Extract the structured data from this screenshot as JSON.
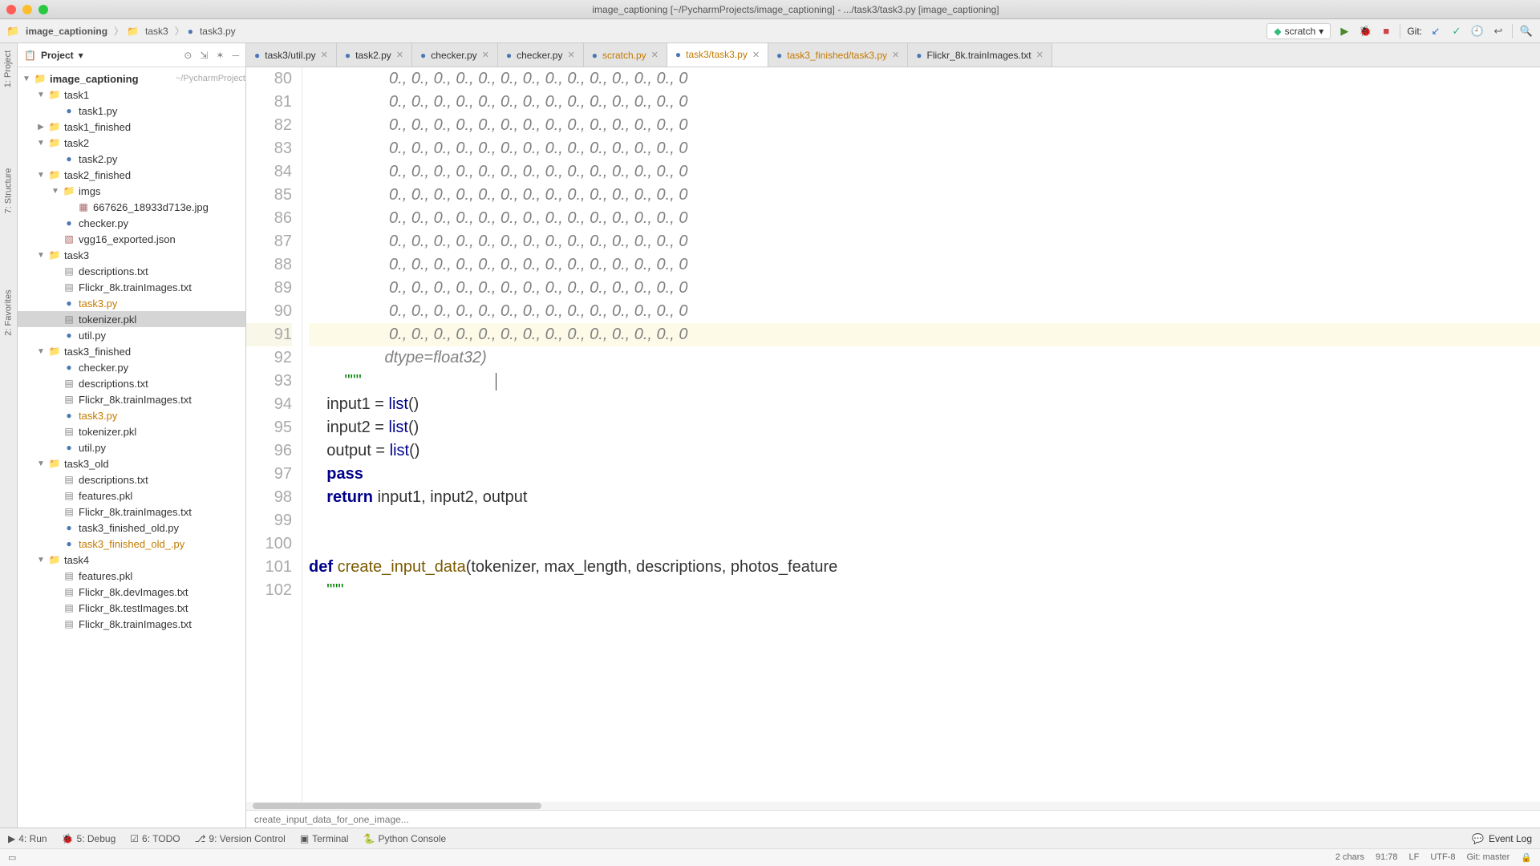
{
  "title": "image_captioning [~/PycharmProjects/image_captioning] - .../task3/task3.py [image_captioning]",
  "breadcrumbs": [
    "image_captioning",
    "task3",
    "task3.py"
  ],
  "run_config": "scratch",
  "git_label": "Git:",
  "project": {
    "label": "Project",
    "root": {
      "name": "image_captioning",
      "hint": "~/PycharmProject"
    }
  },
  "tree": [
    {
      "depth": 0,
      "arrow": "▼",
      "type": "folder",
      "name": "image_captioning",
      "hint": "~/PycharmProject",
      "bold": true
    },
    {
      "depth": 1,
      "arrow": "▼",
      "type": "folder",
      "name": "task1"
    },
    {
      "depth": 2,
      "arrow": "",
      "type": "py",
      "name": "task1.py"
    },
    {
      "depth": 1,
      "arrow": "▶",
      "type": "folder",
      "name": "task1_finished"
    },
    {
      "depth": 1,
      "arrow": "▼",
      "type": "folder",
      "name": "task2"
    },
    {
      "depth": 2,
      "arrow": "",
      "type": "py",
      "name": "task2.py"
    },
    {
      "depth": 1,
      "arrow": "▼",
      "type": "folder",
      "name": "task2_finished"
    },
    {
      "depth": 2,
      "arrow": "▼",
      "type": "folder",
      "name": "imgs"
    },
    {
      "depth": 3,
      "arrow": "",
      "type": "jpg",
      "name": "667626_18933d713e.jpg"
    },
    {
      "depth": 2,
      "arrow": "",
      "type": "py",
      "name": "checker.py"
    },
    {
      "depth": 2,
      "arrow": "",
      "type": "json",
      "name": "vgg16_exported.json"
    },
    {
      "depth": 1,
      "arrow": "▼",
      "type": "folder",
      "name": "task3"
    },
    {
      "depth": 2,
      "arrow": "",
      "type": "txt",
      "name": "descriptions.txt"
    },
    {
      "depth": 2,
      "arrow": "",
      "type": "txt",
      "name": "Flickr_8k.trainImages.txt"
    },
    {
      "depth": 2,
      "arrow": "",
      "type": "py",
      "name": "task3.py",
      "orange": true
    },
    {
      "depth": 2,
      "arrow": "",
      "type": "txt",
      "name": "tokenizer.pkl",
      "sel": true
    },
    {
      "depth": 2,
      "arrow": "",
      "type": "py",
      "name": "util.py"
    },
    {
      "depth": 1,
      "arrow": "▼",
      "type": "folder",
      "name": "task3_finished"
    },
    {
      "depth": 2,
      "arrow": "",
      "type": "py",
      "name": "checker.py"
    },
    {
      "depth": 2,
      "arrow": "",
      "type": "txt",
      "name": "descriptions.txt"
    },
    {
      "depth": 2,
      "arrow": "",
      "type": "txt",
      "name": "Flickr_8k.trainImages.txt"
    },
    {
      "depth": 2,
      "arrow": "",
      "type": "py",
      "name": "task3.py",
      "orange": true
    },
    {
      "depth": 2,
      "arrow": "",
      "type": "txt",
      "name": "tokenizer.pkl"
    },
    {
      "depth": 2,
      "arrow": "",
      "type": "py",
      "name": "util.py"
    },
    {
      "depth": 1,
      "arrow": "▼",
      "type": "folder",
      "name": "task3_old"
    },
    {
      "depth": 2,
      "arrow": "",
      "type": "txt",
      "name": "descriptions.txt"
    },
    {
      "depth": 2,
      "arrow": "",
      "type": "txt",
      "name": "features.pkl"
    },
    {
      "depth": 2,
      "arrow": "",
      "type": "txt",
      "name": "Flickr_8k.trainImages.txt"
    },
    {
      "depth": 2,
      "arrow": "",
      "type": "py",
      "name": "task3_finished_old.py"
    },
    {
      "depth": 2,
      "arrow": "",
      "type": "py",
      "name": "task3_finished_old_.py",
      "orange": true
    },
    {
      "depth": 1,
      "arrow": "▼",
      "type": "folder",
      "name": "task4"
    },
    {
      "depth": 2,
      "arrow": "",
      "type": "txt",
      "name": "features.pkl"
    },
    {
      "depth": 2,
      "arrow": "",
      "type": "txt",
      "name": "Flickr_8k.devImages.txt"
    },
    {
      "depth": 2,
      "arrow": "",
      "type": "txt",
      "name": "Flickr_8k.testImages.txt"
    },
    {
      "depth": 2,
      "arrow": "",
      "type": "txt",
      "name": "Flickr_8k.trainImages.txt"
    }
  ],
  "tabs": [
    {
      "text": "task3/util.py",
      "active": false
    },
    {
      "text": "task2.py",
      "active": false
    },
    {
      "text": "checker.py",
      "active": false
    },
    {
      "text": "checker.py",
      "active": false
    },
    {
      "text": "scratch.py",
      "active": false,
      "orange": true
    },
    {
      "text": "task3/task3.py",
      "active": true,
      "orange": true
    },
    {
      "text": "task3_finished/task3.py",
      "active": false,
      "orange": true
    },
    {
      "text": "Flickr_8k.trainImages.txt",
      "active": false
    }
  ],
  "editor": {
    "first_line": 80,
    "highlight_line": 91,
    "lines": [
      {
        "n": 80,
        "indent": "                  ",
        "text": "0., 0., 0., 0., 0., 0., 0., 0., 0., 0., 0., 0., 0., 0",
        "cls": "comment"
      },
      {
        "n": 81,
        "indent": "                  ",
        "text": "0., 0., 0., 0., 0., 0., 0., 0., 0., 0., 0., 0., 0., 0",
        "cls": "comment"
      },
      {
        "n": 82,
        "indent": "                  ",
        "text": "0., 0., 0., 0., 0., 0., 0., 0., 0., 0., 0., 0., 0., 0",
        "cls": "comment"
      },
      {
        "n": 83,
        "indent": "                  ",
        "text": "0., 0., 0., 0., 0., 0., 0., 0., 0., 0., 0., 0., 0., 0",
        "cls": "comment"
      },
      {
        "n": 84,
        "indent": "                  ",
        "text": "0., 0., 0., 0., 0., 0., 0., 0., 0., 0., 0., 0., 0., 0",
        "cls": "comment"
      },
      {
        "n": 85,
        "indent": "                  ",
        "text": "0., 0., 0., 0., 0., 0., 0., 0., 0., 0., 0., 0., 0., 0",
        "cls": "comment"
      },
      {
        "n": 86,
        "indent": "                  ",
        "text": "0., 0., 0., 0., 0., 0., 0., 0., 0., 0., 0., 0., 0., 0",
        "cls": "comment"
      },
      {
        "n": 87,
        "indent": "                  ",
        "text": "0., 0., 0., 0., 0., 0., 0., 0., 0., 0., 0., 0., 0., 0",
        "cls": "comment"
      },
      {
        "n": 88,
        "indent": "                  ",
        "text": "0., 0., 0., 0., 0., 0., 0., 0., 0., 0., 0., 0., 0., 0",
        "cls": "comment"
      },
      {
        "n": 89,
        "indent": "                  ",
        "text": "0., 0., 0., 0., 0., 0., 0., 0., 0., 0., 0., 0., 0., 0",
        "cls": "comment"
      },
      {
        "n": 90,
        "indent": "                  ",
        "text": "0., 0., 0., 0., 0., 0., 0., 0., 0., 0., 0., 0., 0., 0",
        "cls": "comment"
      },
      {
        "n": 91,
        "indent": "                  ",
        "text": "0., 0., 0., 0., 0., 0., 0., 0., 0., 0., 0., 0., 0., 0",
        "cls": "comment",
        "hl": true
      },
      {
        "n": 92,
        "indent": "                 ",
        "text": "dtype=float32)",
        "cls": "comment"
      },
      {
        "n": 93,
        "indent": "        ",
        "html": "<span class='str'>\"\"\"</span>                             <span class='cursor'></span>"
      },
      {
        "n": 94,
        "indent": "    ",
        "html": "input1 = <span class='builtin'>list</span>()"
      },
      {
        "n": 95,
        "indent": "    ",
        "html": "input2 = <span class='builtin'>list</span>()"
      },
      {
        "n": 96,
        "indent": "    ",
        "html": "output = <span class='builtin'>list</span>()"
      },
      {
        "n": 97,
        "indent": "    ",
        "html": "<span class='kw'>pass</span>"
      },
      {
        "n": 98,
        "indent": "    ",
        "html": "<span class='kw'>return</span> input1, input2, output"
      },
      {
        "n": 99,
        "indent": "",
        "text": ""
      },
      {
        "n": 100,
        "indent": "",
        "text": ""
      },
      {
        "n": 101,
        "indent": "",
        "html": "<span class='kw'>def</span> <span class='fn'>create_input_data</span>(tokenizer, max_length, descriptions, photos_feature"
      },
      {
        "n": 102,
        "indent": "    ",
        "html": "<span class='str'>\"\"\"</span>"
      }
    ],
    "breadcrumb": "create_input_data_for_one_image..."
  },
  "bottom_tools": [
    "4: Run",
    "5: Debug",
    "6: TODO",
    "9: Version Control",
    "Terminal",
    "Python Console"
  ],
  "event_log": "Event Log",
  "status": {
    "chars": "2 chars",
    "pos": "91:78",
    "lf": "LF",
    "enc": "UTF-8",
    "git": "Git: master",
    "lock": "🔒"
  },
  "left_gutter": [
    "1: Project",
    "7: Structure",
    "2: Favorites"
  ]
}
